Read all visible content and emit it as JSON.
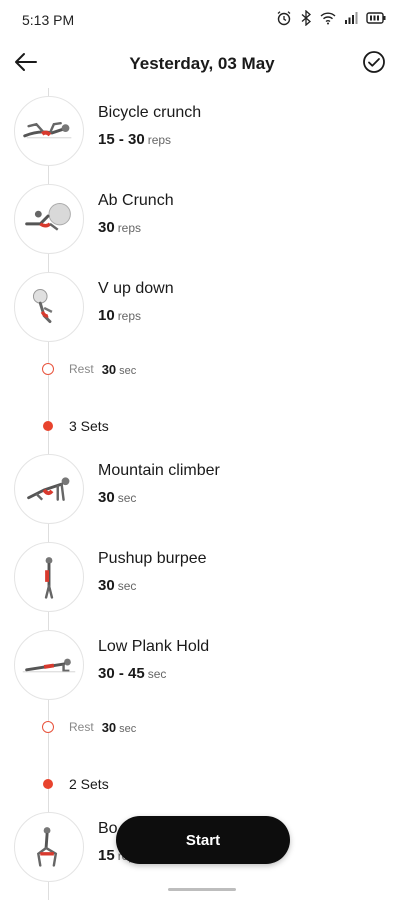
{
  "status_bar": {
    "time": "5:13 PM",
    "icons": [
      "alarm-icon",
      "bluetooth-icon",
      "wifi-icon",
      "signal-icon",
      "battery-icon"
    ]
  },
  "header": {
    "title": "Yesterday, 03 May",
    "back_icon": "arrow-left-icon",
    "confirm_icon": "check-circle-icon"
  },
  "exercises": [
    {
      "name": "Bicycle crunch",
      "qty": "15 - 30",
      "unit": "reps"
    },
    {
      "name": "Ab Crunch",
      "qty": "30",
      "unit": "reps"
    },
    {
      "name": "V up down",
      "qty": "10",
      "unit": "reps"
    },
    {
      "name": "Mountain climber",
      "qty": "30",
      "unit": "sec"
    },
    {
      "name": "Pushup burpee",
      "qty": "30",
      "unit": "sec"
    },
    {
      "name": "Low Plank Hold",
      "qty": "30 - 45",
      "unit": "sec"
    },
    {
      "name": "Bo",
      "qty": "15",
      "unit": "reps"
    }
  ],
  "rests": [
    {
      "label": "Rest",
      "value": "30",
      "unit": "sec"
    },
    {
      "label": "Rest",
      "value": "30",
      "unit": "sec"
    }
  ],
  "sets": [
    {
      "label": "3 Sets"
    },
    {
      "label": "2 Sets"
    }
  ],
  "start_button": {
    "label": "Start"
  },
  "colors": {
    "accent": "#e8432d",
    "button_bg": "#0d0d0d",
    "timeline": "#dedede"
  }
}
